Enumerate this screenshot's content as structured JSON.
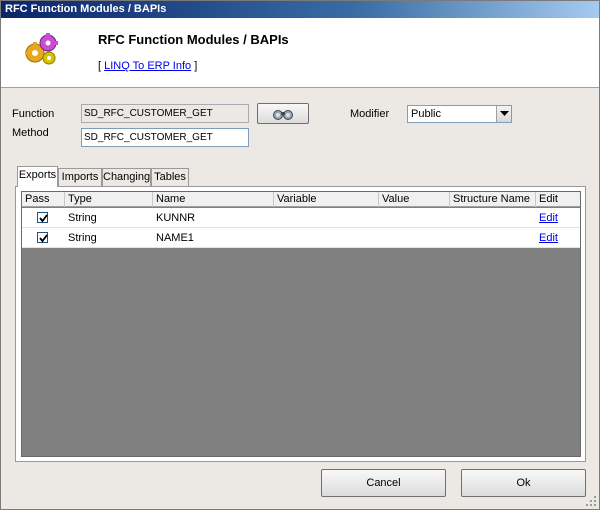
{
  "window": {
    "title": "RFC Function Modules / BAPIs"
  },
  "header": {
    "title": "RFC Function Modules / BAPIs",
    "link_prefix": "[ ",
    "link_text": "LINQ To ERP Info",
    "link_suffix": " ]"
  },
  "form": {
    "function_label": "Function",
    "function_value": "SD_RFC_CUSTOMER_GET",
    "method_label": "Method",
    "method_value": "SD_RFC_CUSTOMER_GET",
    "modifier_label": "Modifier",
    "modifier_value": "Public"
  },
  "tabs": [
    "Exports",
    "Imports",
    "Changing",
    "Tables"
  ],
  "grid": {
    "columns": [
      "Pass",
      "Type",
      "Name",
      "Variable",
      "Value",
      "Structure Name",
      "Edit"
    ],
    "rows": [
      {
        "pass": true,
        "type": "String",
        "name": "KUNNR",
        "variable": "",
        "value": "",
        "structure": "",
        "edit": "Edit"
      },
      {
        "pass": true,
        "type": "String",
        "name": "NAME1",
        "variable": "",
        "value": "",
        "structure": "",
        "edit": "Edit"
      }
    ]
  },
  "buttons": {
    "cancel": "Cancel",
    "ok": "Ok"
  },
  "icons": {
    "logo": "gears-icon",
    "browse": "binoculars-icon",
    "dropdown": "chevron-down-icon"
  }
}
